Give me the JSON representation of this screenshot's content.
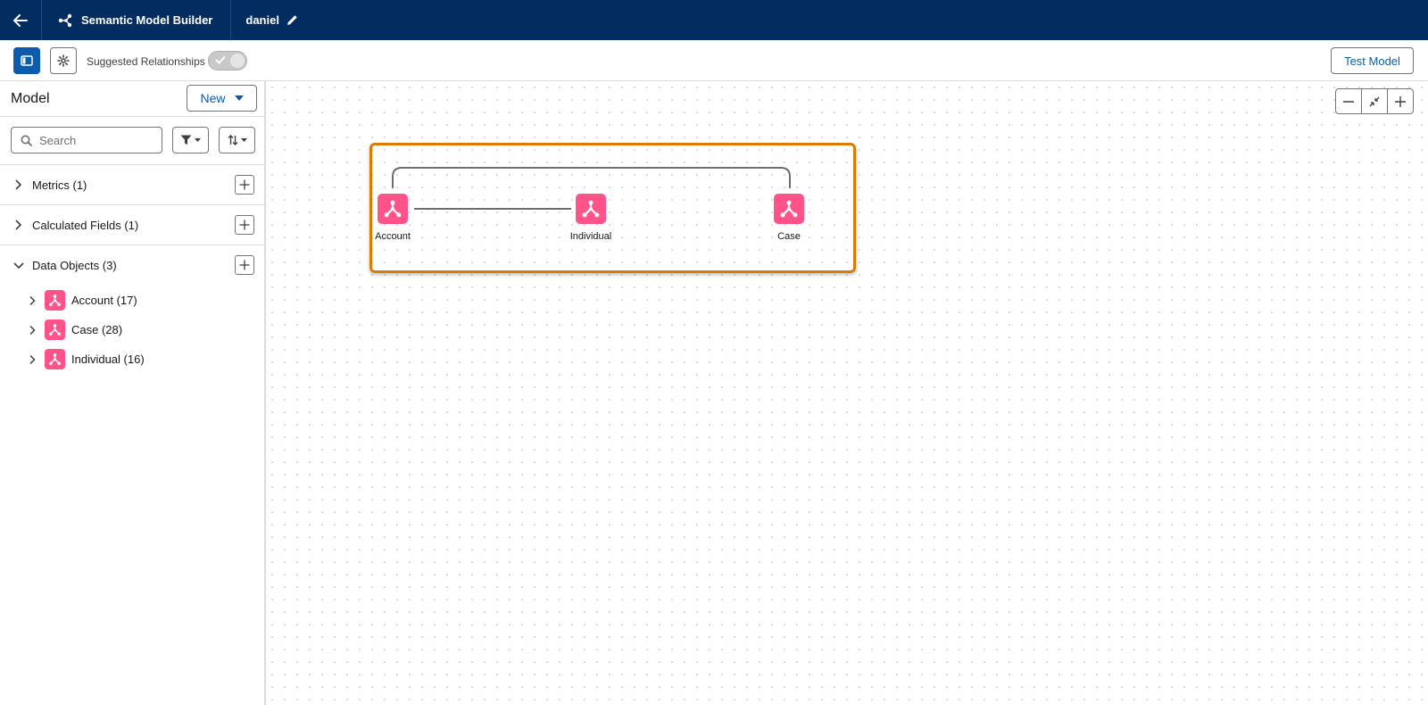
{
  "header": {
    "app_title": "Semantic Model Builder",
    "model_name": "daniel"
  },
  "toolbar": {
    "suggested_label": "Suggested Relationships",
    "suggested_enabled": false,
    "test_label": "Test Model"
  },
  "sidebar": {
    "title": "Model",
    "new_label": "New",
    "search_placeholder": "Search",
    "sections": [
      {
        "label": "Metrics (1)"
      },
      {
        "label": "Calculated Fields (1)"
      },
      {
        "label": "Data Objects (3)"
      }
    ],
    "objects": [
      {
        "label": "Account (17)"
      },
      {
        "label": "Case (28)"
      },
      {
        "label": "Individual (16)"
      }
    ]
  },
  "canvas": {
    "nodes": [
      {
        "label": "Account"
      },
      {
        "label": "Individual"
      },
      {
        "label": "Case"
      }
    ]
  },
  "colors": {
    "header_bg": "#032d60",
    "brand_blue": "#0b5cab",
    "object_pink": "#ff538a",
    "selection_orange": "#dd7a01"
  }
}
